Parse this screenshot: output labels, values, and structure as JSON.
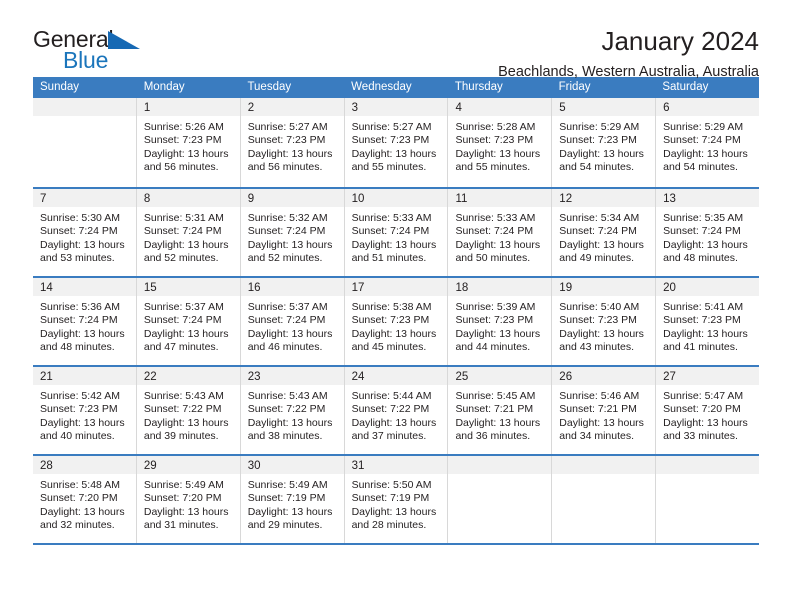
{
  "logo": {
    "primary_text": "General",
    "secondary_text": "Blue",
    "triangle_icon": "triangle-icon",
    "primary_color": "#231f20",
    "secondary_color": "#1b75bb"
  },
  "header": {
    "title": "January 2024",
    "location": "Beachlands, Western Australia, Australia"
  },
  "theme": {
    "header_blue": "#3a7cc0",
    "band_gray": "#f1f1f1",
    "divider_gray": "#d8d8d8",
    "text_color": "#231f20"
  },
  "calendar": {
    "weekday_headers": [
      "Sunday",
      "Monday",
      "Tuesday",
      "Wednesday",
      "Thursday",
      "Friday",
      "Saturday"
    ],
    "weeks": [
      [
        {
          "day": "",
          "sunrise": "",
          "sunset": "",
          "daylight_line1": "",
          "daylight_line2": "",
          "empty": true
        },
        {
          "day": "1",
          "sunrise": "Sunrise: 5:26 AM",
          "sunset": "Sunset: 7:23 PM",
          "daylight_line1": "Daylight: 13 hours",
          "daylight_line2": "and 56 minutes.",
          "empty": false
        },
        {
          "day": "2",
          "sunrise": "Sunrise: 5:27 AM",
          "sunset": "Sunset: 7:23 PM",
          "daylight_line1": "Daylight: 13 hours",
          "daylight_line2": "and 56 minutes.",
          "empty": false
        },
        {
          "day": "3",
          "sunrise": "Sunrise: 5:27 AM",
          "sunset": "Sunset: 7:23 PM",
          "daylight_line1": "Daylight: 13 hours",
          "daylight_line2": "and 55 minutes.",
          "empty": false
        },
        {
          "day": "4",
          "sunrise": "Sunrise: 5:28 AM",
          "sunset": "Sunset: 7:23 PM",
          "daylight_line1": "Daylight: 13 hours",
          "daylight_line2": "and 55 minutes.",
          "empty": false
        },
        {
          "day": "5",
          "sunrise": "Sunrise: 5:29 AM",
          "sunset": "Sunset: 7:23 PM",
          "daylight_line1": "Daylight: 13 hours",
          "daylight_line2": "and 54 minutes.",
          "empty": false
        },
        {
          "day": "6",
          "sunrise": "Sunrise: 5:29 AM",
          "sunset": "Sunset: 7:24 PM",
          "daylight_line1": "Daylight: 13 hours",
          "daylight_line2": "and 54 minutes.",
          "empty": false
        }
      ],
      [
        {
          "day": "7",
          "sunrise": "Sunrise: 5:30 AM",
          "sunset": "Sunset: 7:24 PM",
          "daylight_line1": "Daylight: 13 hours",
          "daylight_line2": "and 53 minutes.",
          "empty": false
        },
        {
          "day": "8",
          "sunrise": "Sunrise: 5:31 AM",
          "sunset": "Sunset: 7:24 PM",
          "daylight_line1": "Daylight: 13 hours",
          "daylight_line2": "and 52 minutes.",
          "empty": false
        },
        {
          "day": "9",
          "sunrise": "Sunrise: 5:32 AM",
          "sunset": "Sunset: 7:24 PM",
          "daylight_line1": "Daylight: 13 hours",
          "daylight_line2": "and 52 minutes.",
          "empty": false
        },
        {
          "day": "10",
          "sunrise": "Sunrise: 5:33 AM",
          "sunset": "Sunset: 7:24 PM",
          "daylight_line1": "Daylight: 13 hours",
          "daylight_line2": "and 51 minutes.",
          "empty": false
        },
        {
          "day": "11",
          "sunrise": "Sunrise: 5:33 AM",
          "sunset": "Sunset: 7:24 PM",
          "daylight_line1": "Daylight: 13 hours",
          "daylight_line2": "and 50 minutes.",
          "empty": false
        },
        {
          "day": "12",
          "sunrise": "Sunrise: 5:34 AM",
          "sunset": "Sunset: 7:24 PM",
          "daylight_line1": "Daylight: 13 hours",
          "daylight_line2": "and 49 minutes.",
          "empty": false
        },
        {
          "day": "13",
          "sunrise": "Sunrise: 5:35 AM",
          "sunset": "Sunset: 7:24 PM",
          "daylight_line1": "Daylight: 13 hours",
          "daylight_line2": "and 48 minutes.",
          "empty": false
        }
      ],
      [
        {
          "day": "14",
          "sunrise": "Sunrise: 5:36 AM",
          "sunset": "Sunset: 7:24 PM",
          "daylight_line1": "Daylight: 13 hours",
          "daylight_line2": "and 48 minutes.",
          "empty": false
        },
        {
          "day": "15",
          "sunrise": "Sunrise: 5:37 AM",
          "sunset": "Sunset: 7:24 PM",
          "daylight_line1": "Daylight: 13 hours",
          "daylight_line2": "and 47 minutes.",
          "empty": false
        },
        {
          "day": "16",
          "sunrise": "Sunrise: 5:37 AM",
          "sunset": "Sunset: 7:24 PM",
          "daylight_line1": "Daylight: 13 hours",
          "daylight_line2": "and 46 minutes.",
          "empty": false
        },
        {
          "day": "17",
          "sunrise": "Sunrise: 5:38 AM",
          "sunset": "Sunset: 7:23 PM",
          "daylight_line1": "Daylight: 13 hours",
          "daylight_line2": "and 45 minutes.",
          "empty": false
        },
        {
          "day": "18",
          "sunrise": "Sunrise: 5:39 AM",
          "sunset": "Sunset: 7:23 PM",
          "daylight_line1": "Daylight: 13 hours",
          "daylight_line2": "and 44 minutes.",
          "empty": false
        },
        {
          "day": "19",
          "sunrise": "Sunrise: 5:40 AM",
          "sunset": "Sunset: 7:23 PM",
          "daylight_line1": "Daylight: 13 hours",
          "daylight_line2": "and 43 minutes.",
          "empty": false
        },
        {
          "day": "20",
          "sunrise": "Sunrise: 5:41 AM",
          "sunset": "Sunset: 7:23 PM",
          "daylight_line1": "Daylight: 13 hours",
          "daylight_line2": "and 41 minutes.",
          "empty": false
        }
      ],
      [
        {
          "day": "21",
          "sunrise": "Sunrise: 5:42 AM",
          "sunset": "Sunset: 7:23 PM",
          "daylight_line1": "Daylight: 13 hours",
          "daylight_line2": "and 40 minutes.",
          "empty": false
        },
        {
          "day": "22",
          "sunrise": "Sunrise: 5:43 AM",
          "sunset": "Sunset: 7:22 PM",
          "daylight_line1": "Daylight: 13 hours",
          "daylight_line2": "and 39 minutes.",
          "empty": false
        },
        {
          "day": "23",
          "sunrise": "Sunrise: 5:43 AM",
          "sunset": "Sunset: 7:22 PM",
          "daylight_line1": "Daylight: 13 hours",
          "daylight_line2": "and 38 minutes.",
          "empty": false
        },
        {
          "day": "24",
          "sunrise": "Sunrise: 5:44 AM",
          "sunset": "Sunset: 7:22 PM",
          "daylight_line1": "Daylight: 13 hours",
          "daylight_line2": "and 37 minutes.",
          "empty": false
        },
        {
          "day": "25",
          "sunrise": "Sunrise: 5:45 AM",
          "sunset": "Sunset: 7:21 PM",
          "daylight_line1": "Daylight: 13 hours",
          "daylight_line2": "and 36 minutes.",
          "empty": false
        },
        {
          "day": "26",
          "sunrise": "Sunrise: 5:46 AM",
          "sunset": "Sunset: 7:21 PM",
          "daylight_line1": "Daylight: 13 hours",
          "daylight_line2": "and 34 minutes.",
          "empty": false
        },
        {
          "day": "27",
          "sunrise": "Sunrise: 5:47 AM",
          "sunset": "Sunset: 7:20 PM",
          "daylight_line1": "Daylight: 13 hours",
          "daylight_line2": "and 33 minutes.",
          "empty": false
        }
      ],
      [
        {
          "day": "28",
          "sunrise": "Sunrise: 5:48 AM",
          "sunset": "Sunset: 7:20 PM",
          "daylight_line1": "Daylight: 13 hours",
          "daylight_line2": "and 32 minutes.",
          "empty": false
        },
        {
          "day": "29",
          "sunrise": "Sunrise: 5:49 AM",
          "sunset": "Sunset: 7:20 PM",
          "daylight_line1": "Daylight: 13 hours",
          "daylight_line2": "and 31 minutes.",
          "empty": false
        },
        {
          "day": "30",
          "sunrise": "Sunrise: 5:49 AM",
          "sunset": "Sunset: 7:19 PM",
          "daylight_line1": "Daylight: 13 hours",
          "daylight_line2": "and 29 minutes.",
          "empty": false
        },
        {
          "day": "31",
          "sunrise": "Sunrise: 5:50 AM",
          "sunset": "Sunset: 7:19 PM",
          "daylight_line1": "Daylight: 13 hours",
          "daylight_line2": "and 28 minutes.",
          "empty": false
        },
        {
          "day": "",
          "sunrise": "",
          "sunset": "",
          "daylight_line1": "",
          "daylight_line2": "",
          "empty": true
        },
        {
          "day": "",
          "sunrise": "",
          "sunset": "",
          "daylight_line1": "",
          "daylight_line2": "",
          "empty": true
        },
        {
          "day": "",
          "sunrise": "",
          "sunset": "",
          "daylight_line1": "",
          "daylight_line2": "",
          "empty": true
        }
      ]
    ]
  }
}
